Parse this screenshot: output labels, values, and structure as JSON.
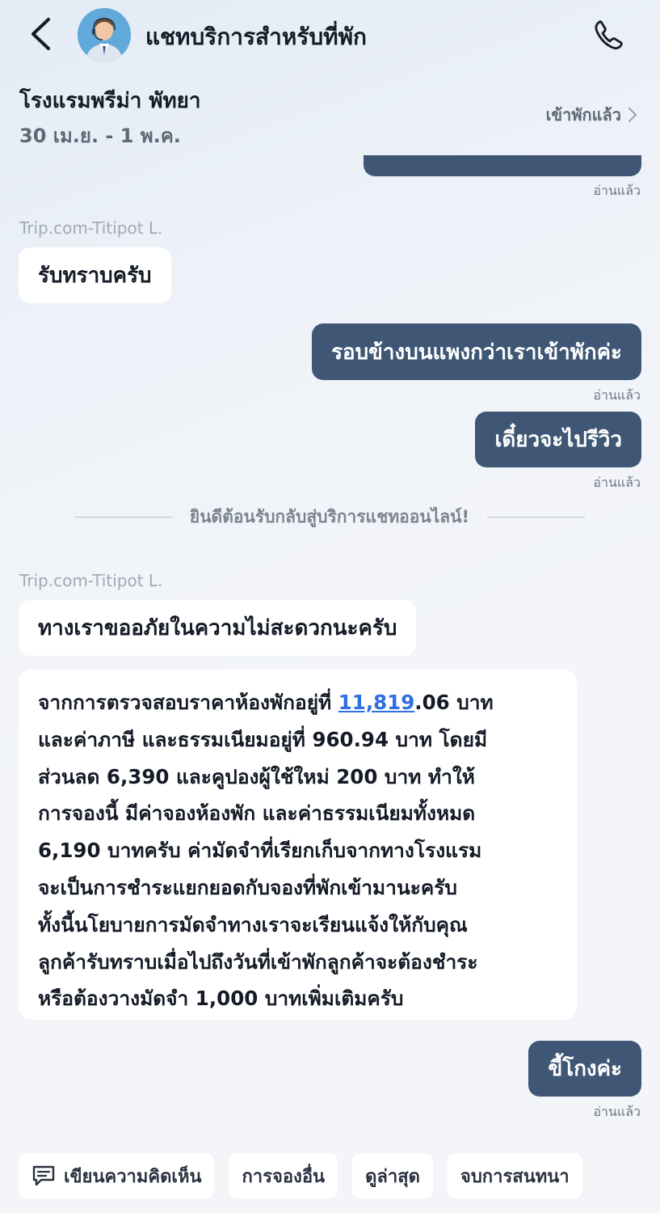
{
  "header": {
    "title": "แชทบริการสำหรับที่พัก",
    "back_icon": "chevron-left-icon",
    "avatar_icon": "agent-avatar",
    "phone_icon": "phone-icon"
  },
  "booking": {
    "hotel_name": "โรงแรมพรีม่า พัทยา",
    "dates": "30 เม.ย. - 1 พ.ค.",
    "status": "เข้าพักแล้ว"
  },
  "messages": {
    "read_label": "อ่านแล้ว",
    "sender_1": "Trip.com-Titipot L.",
    "in_1": "รับทราบครับ",
    "out_1": "รอบข้างบนแพงกว่าเราเข้าพักค่ะ",
    "out_2": "เดี๋ยวจะไปรีวิว",
    "system_divider": "ยินดีต้อนรับกลับสู่บริการแชทออนไลน์!",
    "sender_2": "Trip.com-Titipot L.",
    "in_2": "ทางเราขออภัยในความไม่สะดวกนะครับ",
    "in_3": {
      "line1_pre": "จากการตรวจสอบราคาห้องพักอยู่ที่ ",
      "line1_link": "11,819",
      "line1_post": ".06 บาท",
      "line2": "และค่าภาษี และธรรมเนียมอยู่ที่ 960.94 บาท โดยมี",
      "line3": "ส่วนลด 6,390 และคูปองผู้ใช้ใหม่ 200 บาท ทำให้",
      "line4": "การจองนี้ มีค่าจองห้องพัก และค่าธรรมเนียมทั้งหมด",
      "line5": "6,190 บาทครับ ค่ามัดจำที่เรียกเก็บจากทางโรงแรม",
      "line6": "จะเป็นการชำระแยกยอดกับจองที่พักเข้ามานะครับ",
      "line7": "ทั้งนี้นโยบายการมัดจำทางเราจะเรียนแจ้งให้กับคุณ",
      "line8": "ลูกค้ารับทราบเมื่อไปถึงวันที่เข้าพักลูกค้าจะต้องชำระ",
      "line9": "หรือต้องวางมัดจำ 1,000 บาทเพิ่มเติมครับ"
    },
    "out_3": "ขี้โกงค่ะ"
  },
  "actions": {
    "feedback": "เขียนความคิดเห็น",
    "other_bookings": "การจองอื่น",
    "latest": "ดูล่าสุด",
    "end_chat": "จบการสนทนา",
    "feedback_icon": "comment-icon"
  },
  "colors": {
    "outgoing_bubble": "#3f5775",
    "incoming_bubble": "#ffffff",
    "link": "#2f6fe0"
  }
}
